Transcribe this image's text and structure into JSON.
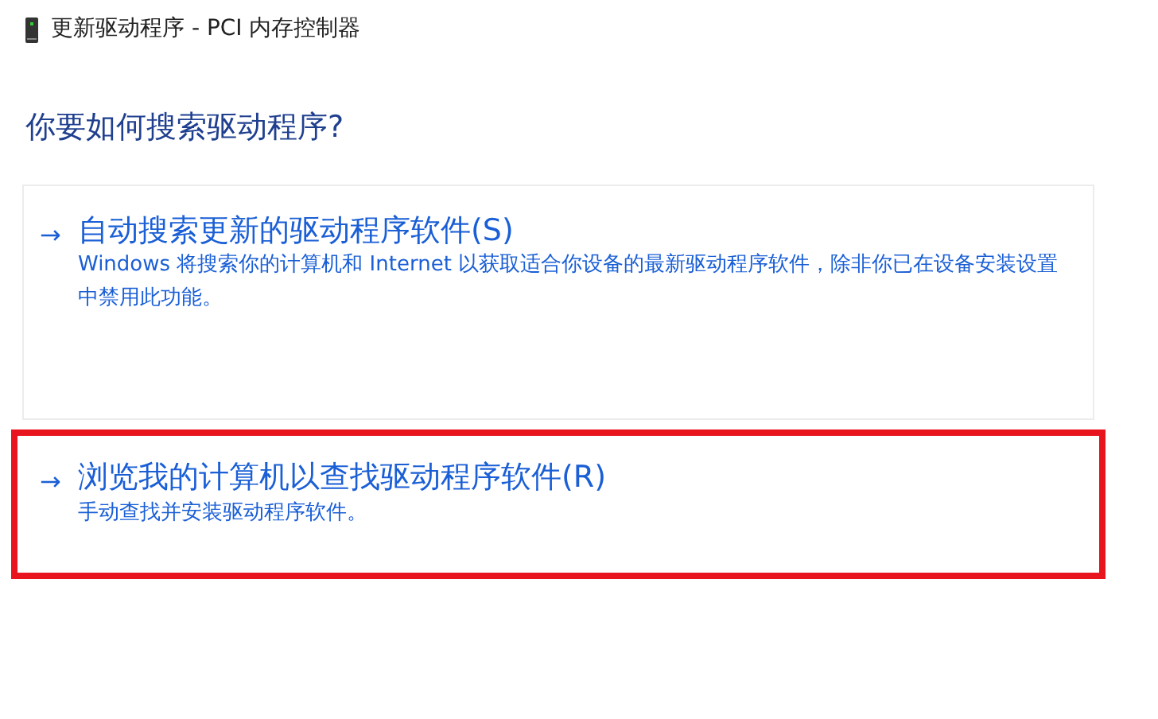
{
  "window": {
    "title": "更新驱动程序 - PCI 内存控制器"
  },
  "heading": "你要如何搜索驱动程序?",
  "options": [
    {
      "arrow": "→",
      "title": "自动搜索更新的驱动程序软件(S)",
      "description": "Windows 将搜索你的计算机和 Internet 以获取适合你设备的最新驱动程序软件，除非你已在设备安装设置中禁用此功能。",
      "highlighted": false
    },
    {
      "arrow": "→",
      "title": "浏览我的计算机以查找驱动程序软件(R)",
      "description": "手动查找并安装驱动程序软件。",
      "highlighted": true
    }
  ]
}
